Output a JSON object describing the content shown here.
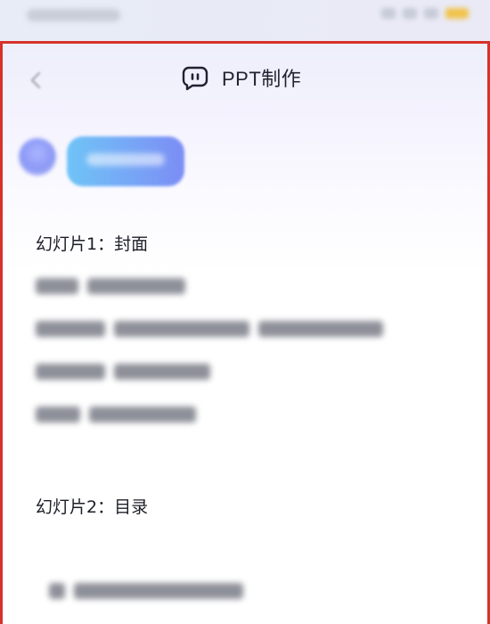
{
  "status_bar": {},
  "header": {
    "title": "PPT制作"
  },
  "slides": [
    {
      "heading": "幻灯片1：封面"
    },
    {
      "heading": "幻灯片2：目录"
    }
  ],
  "icons": {
    "back": "chevron-left-icon",
    "bot": "chat-bot-icon"
  },
  "colors": {
    "frame_border": "#d7322a",
    "bubble_start": "#6fc4f7",
    "bubble_end": "#7c8df5",
    "battery": "#f1c24a",
    "text": "#1f2230"
  }
}
